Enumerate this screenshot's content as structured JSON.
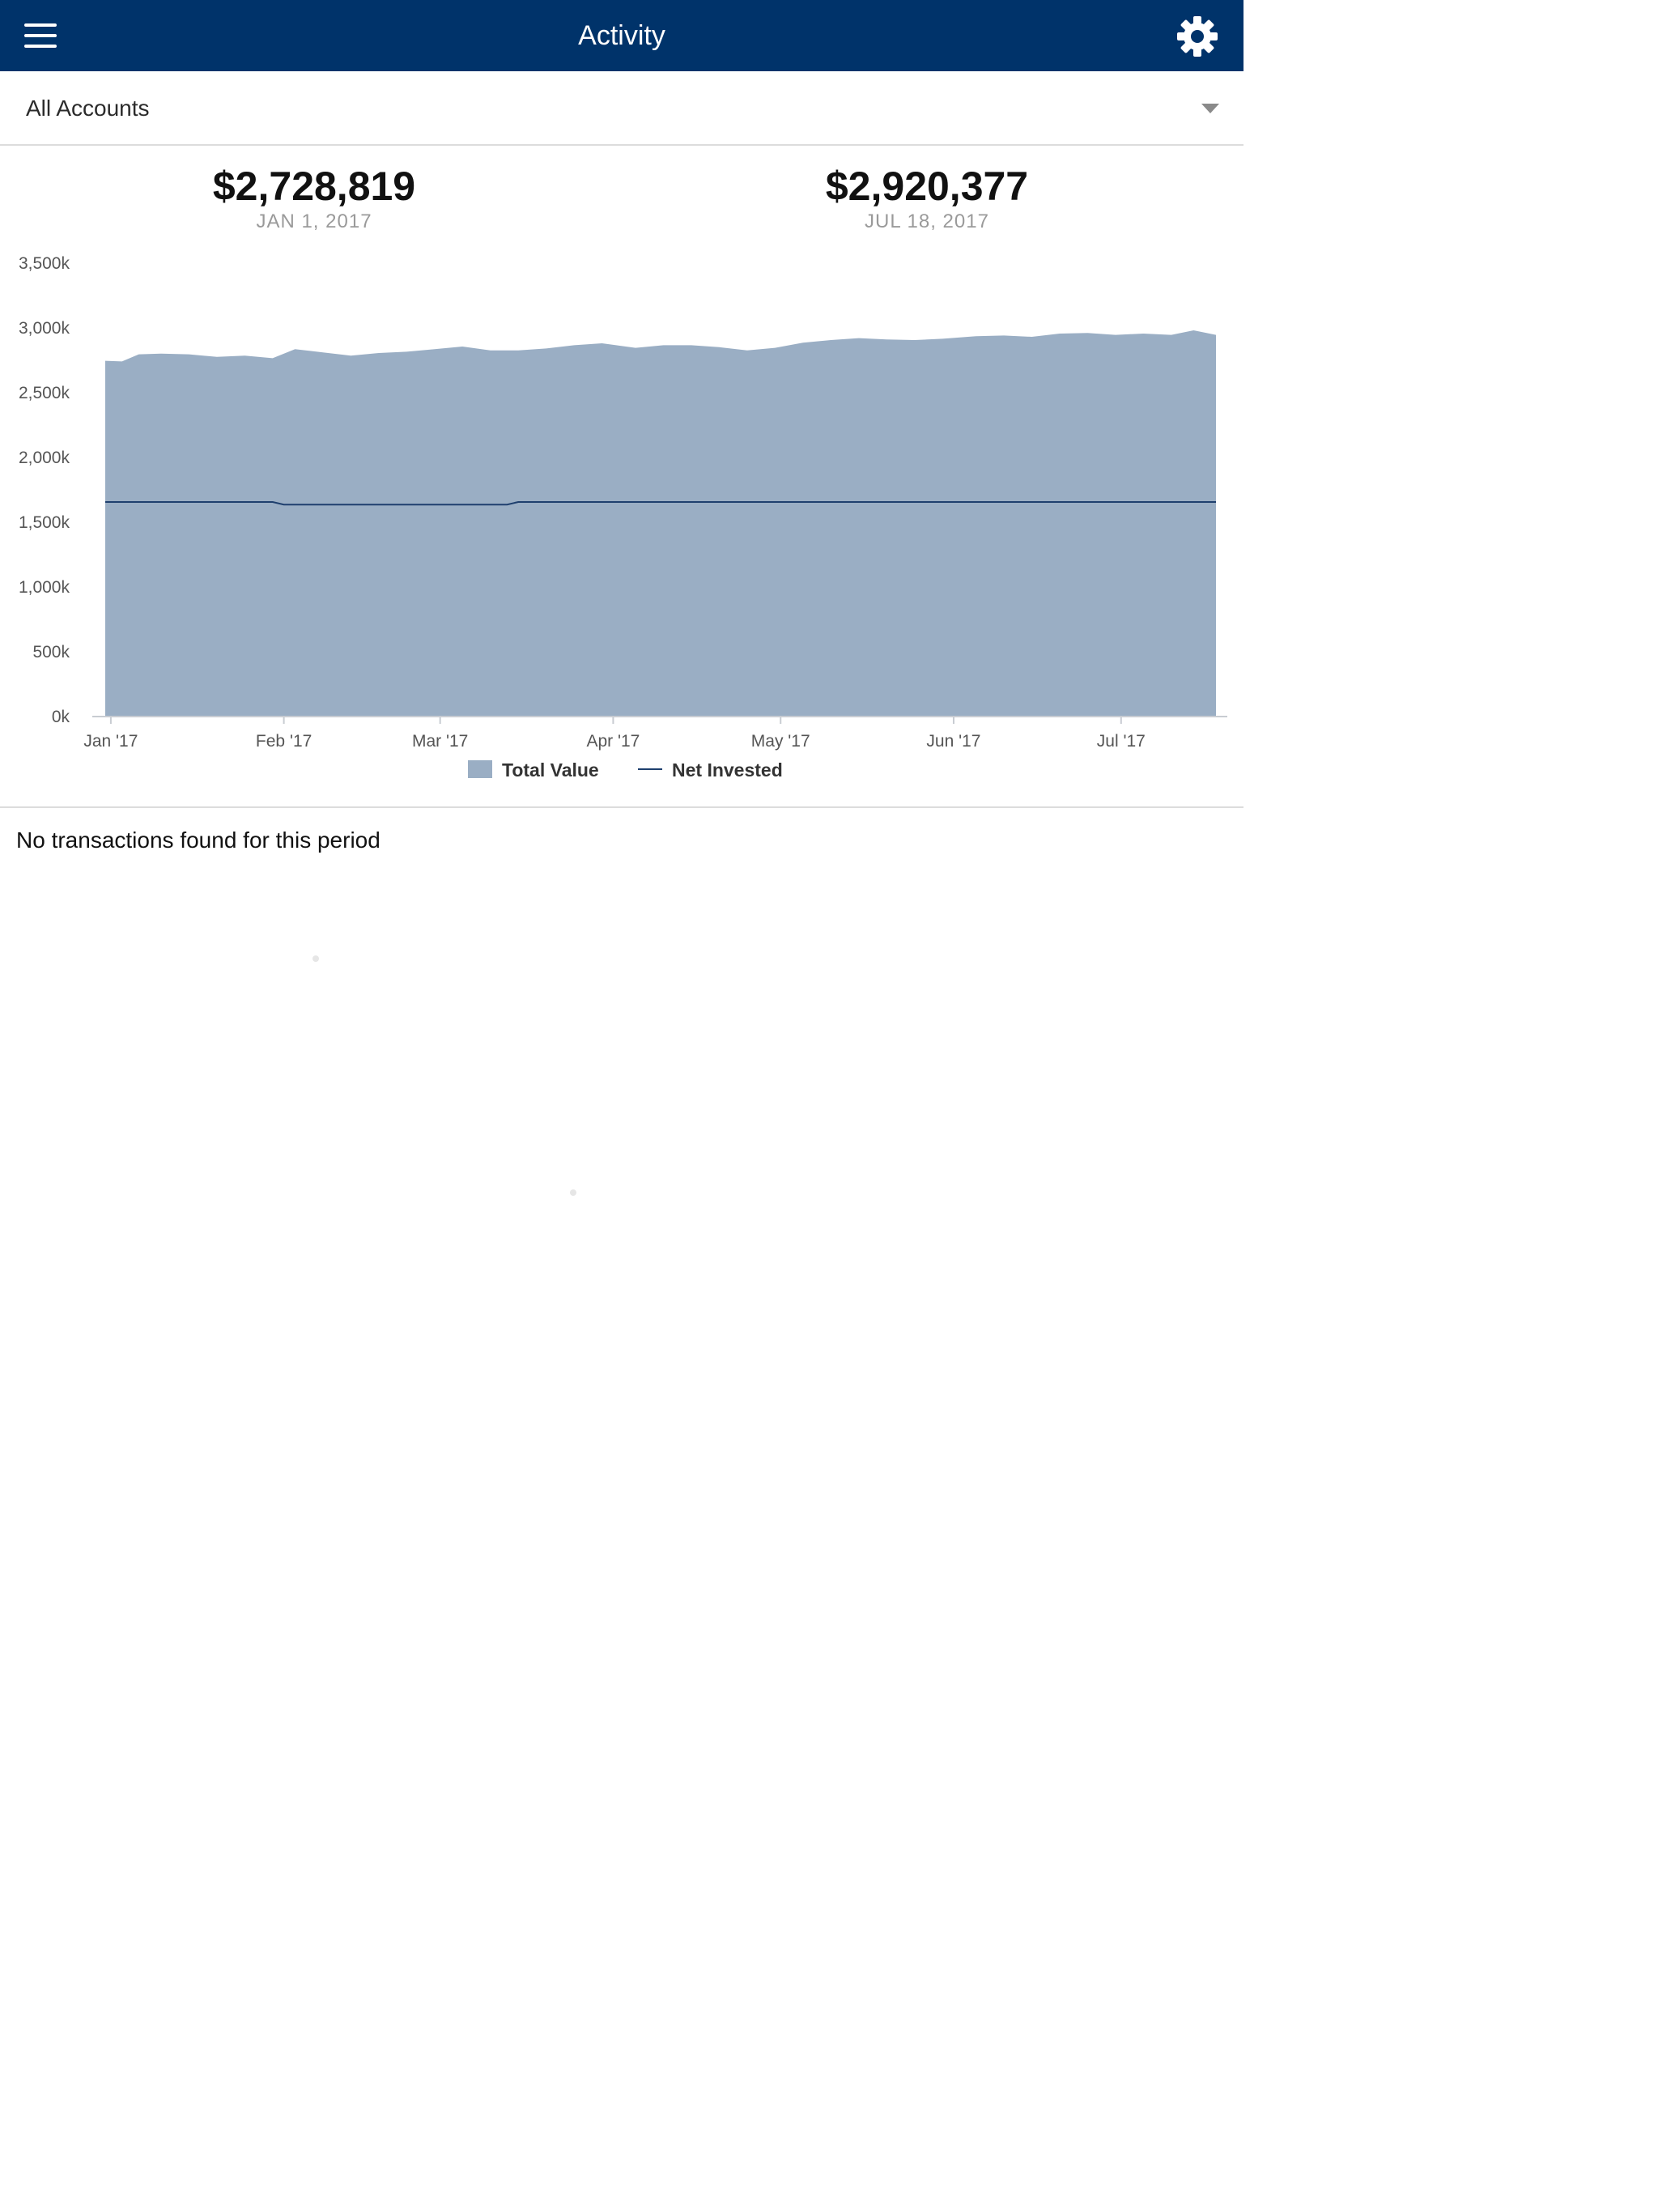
{
  "header": {
    "title": "Activity",
    "menu_icon": "hamburger-menu-icon",
    "settings_icon": "gear-icon",
    "background_color": "#00336a"
  },
  "account_selector": {
    "selected": "All Accounts",
    "icon": "chevron-down-icon"
  },
  "summary": {
    "start": {
      "amount": "$2,728,819",
      "date": "JAN 1, 2017"
    },
    "end": {
      "amount": "$2,920,377",
      "date": "JUL 18, 2017"
    }
  },
  "chart_data": {
    "type": "area",
    "ylim": [
      0,
      3500
    ],
    "y_ticks": [
      0,
      500,
      1000,
      1500,
      2000,
      2500,
      3000,
      3500
    ],
    "y_tick_labels": [
      "0k",
      "500k",
      "1,000k",
      "1,500k",
      "2,000k",
      "2,500k",
      "3,000k",
      "3,500k"
    ],
    "x_ticks": [
      "2017-01-01",
      "2017-02-01",
      "2017-03-01",
      "2017-04-01",
      "2017-05-01",
      "2017-06-01",
      "2017-07-01"
    ],
    "x_tick_labels": [
      "Jan '17",
      "Feb '17",
      "Mar '17",
      "Apr '17",
      "May '17",
      "Jun '17",
      "Jul '17"
    ],
    "xlim": [
      "2016-12-31",
      "2017-07-18"
    ],
    "grid": false,
    "legend_position": "bottom",
    "series": [
      {
        "name": "Total Value",
        "style": "area",
        "color": "#9aaec4",
        "x": [
          "2016-12-31",
          "2017-01-03",
          "2017-01-06",
          "2017-01-10",
          "2017-01-15",
          "2017-01-20",
          "2017-01-25",
          "2017-01-30",
          "2017-02-03",
          "2017-02-08",
          "2017-02-13",
          "2017-02-18",
          "2017-02-23",
          "2017-02-28",
          "2017-03-05",
          "2017-03-10",
          "2017-03-15",
          "2017-03-20",
          "2017-03-25",
          "2017-03-30",
          "2017-04-05",
          "2017-04-10",
          "2017-04-15",
          "2017-04-20",
          "2017-04-25",
          "2017-04-30",
          "2017-05-05",
          "2017-05-10",
          "2017-05-15",
          "2017-05-20",
          "2017-05-25",
          "2017-05-30",
          "2017-06-05",
          "2017-06-10",
          "2017-06-15",
          "2017-06-20",
          "2017-06-25",
          "2017-06-30",
          "2017-07-05",
          "2017-07-10",
          "2017-07-14",
          "2017-07-18"
        ],
        "values": [
          2740,
          2735,
          2790,
          2795,
          2790,
          2770,
          2780,
          2760,
          2830,
          2805,
          2780,
          2800,
          2810,
          2830,
          2850,
          2820,
          2820,
          2835,
          2860,
          2875,
          2840,
          2860,
          2860,
          2845,
          2820,
          2840,
          2880,
          2900,
          2915,
          2905,
          2900,
          2910,
          2930,
          2935,
          2925,
          2950,
          2955,
          2940,
          2950,
          2940,
          2975,
          2940
        ]
      },
      {
        "name": "Net Invested",
        "style": "line",
        "color": "#1e3f6e",
        "x": [
          "2016-12-31",
          "2017-01-30",
          "2017-02-01",
          "2017-03-13",
          "2017-03-15",
          "2017-07-18"
        ],
        "values": [
          1650,
          1650,
          1630,
          1630,
          1650,
          1650
        ]
      }
    ],
    "legend": [
      {
        "name": "Total Value",
        "swatch": "area"
      },
      {
        "name": "Net Invested",
        "swatch": "line"
      }
    ]
  },
  "transactions": {
    "empty_message": "No transactions found for this period"
  }
}
